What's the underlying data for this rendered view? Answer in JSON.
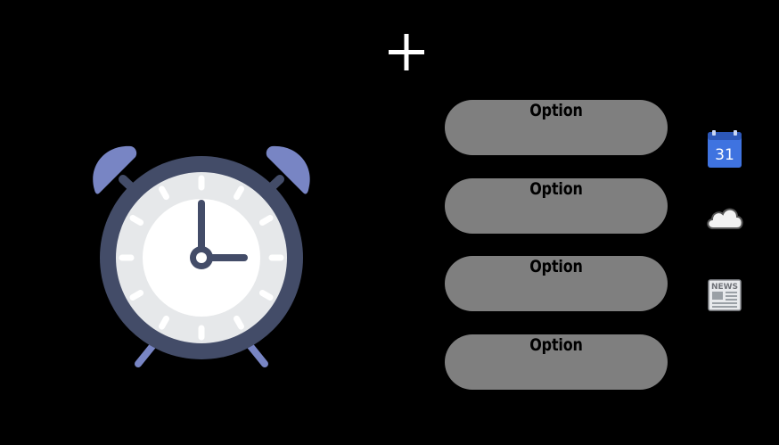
{
  "toolbar": {
    "add_icon": "plus-icon"
  },
  "clock_widget": {
    "icon": "alarm-clock-icon",
    "colors": {
      "bells": "#7885c4",
      "rim": "#434c68",
      "face": "#e6e8ea",
      "inner_face": "#ffffff",
      "hands": "#434c68"
    }
  },
  "options": [
    {
      "label": "Option"
    },
    {
      "label": "Option"
    },
    {
      "label": "Option"
    },
    {
      "label": "Option"
    }
  ],
  "side_icons": {
    "calendar": {
      "icon": "calendar-icon",
      "day": "31"
    },
    "weather": {
      "icon": "cloud-icon"
    },
    "news": {
      "icon": "newspaper-icon",
      "word": "NEWS"
    }
  },
  "colors": {
    "background": "#000000",
    "option_fill": "#7f7f7f",
    "option_text": "#000000",
    "plus": "#ffffff",
    "calendar_blue": "#3f73e0"
  }
}
